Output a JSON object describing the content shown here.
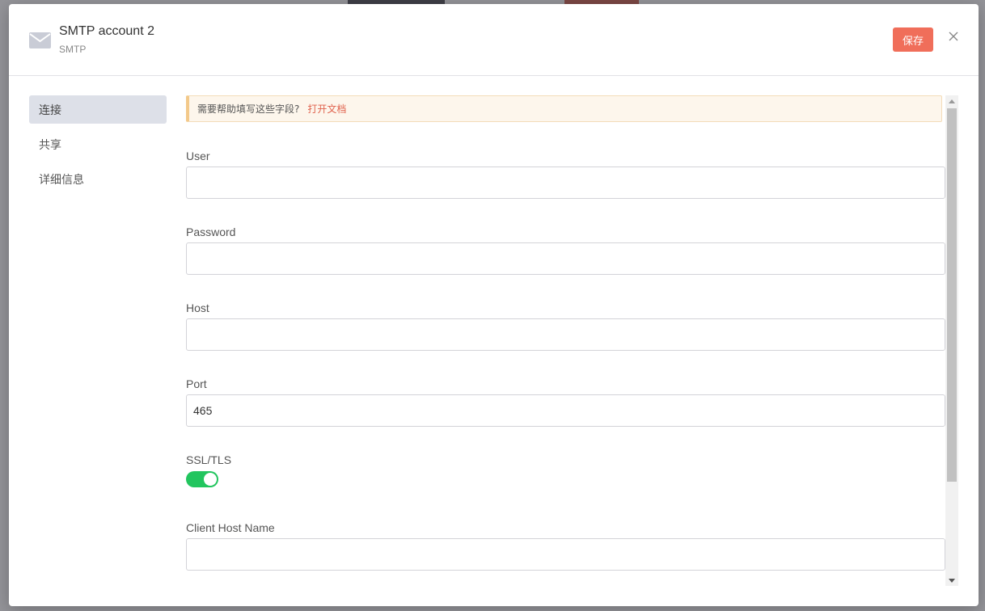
{
  "header": {
    "title": "SMTP account 2",
    "subtitle": "SMTP",
    "save_label": "保存"
  },
  "sidebar": {
    "items": [
      {
        "label": "连接",
        "active": true
      },
      {
        "label": "共享",
        "active": false
      },
      {
        "label": "详细信息",
        "active": false
      }
    ]
  },
  "notice": {
    "text": "需要帮助填写这些字段?",
    "link": "打开文档"
  },
  "fields": {
    "user": {
      "label": "User",
      "value": ""
    },
    "password": {
      "label": "Password",
      "value": ""
    },
    "host": {
      "label": "Host",
      "value": ""
    },
    "port": {
      "label": "Port",
      "value": "465"
    },
    "ssl": {
      "label": "SSL/TLS",
      "on": true
    },
    "client_host": {
      "label": "Client Host Name",
      "value": ""
    }
  },
  "colors": {
    "accent": "#f06e5a",
    "toggle_on": "#22c55e",
    "active_nav": "#dde0e8"
  },
  "icons": {
    "header": "mail-icon",
    "close": "close-icon"
  }
}
